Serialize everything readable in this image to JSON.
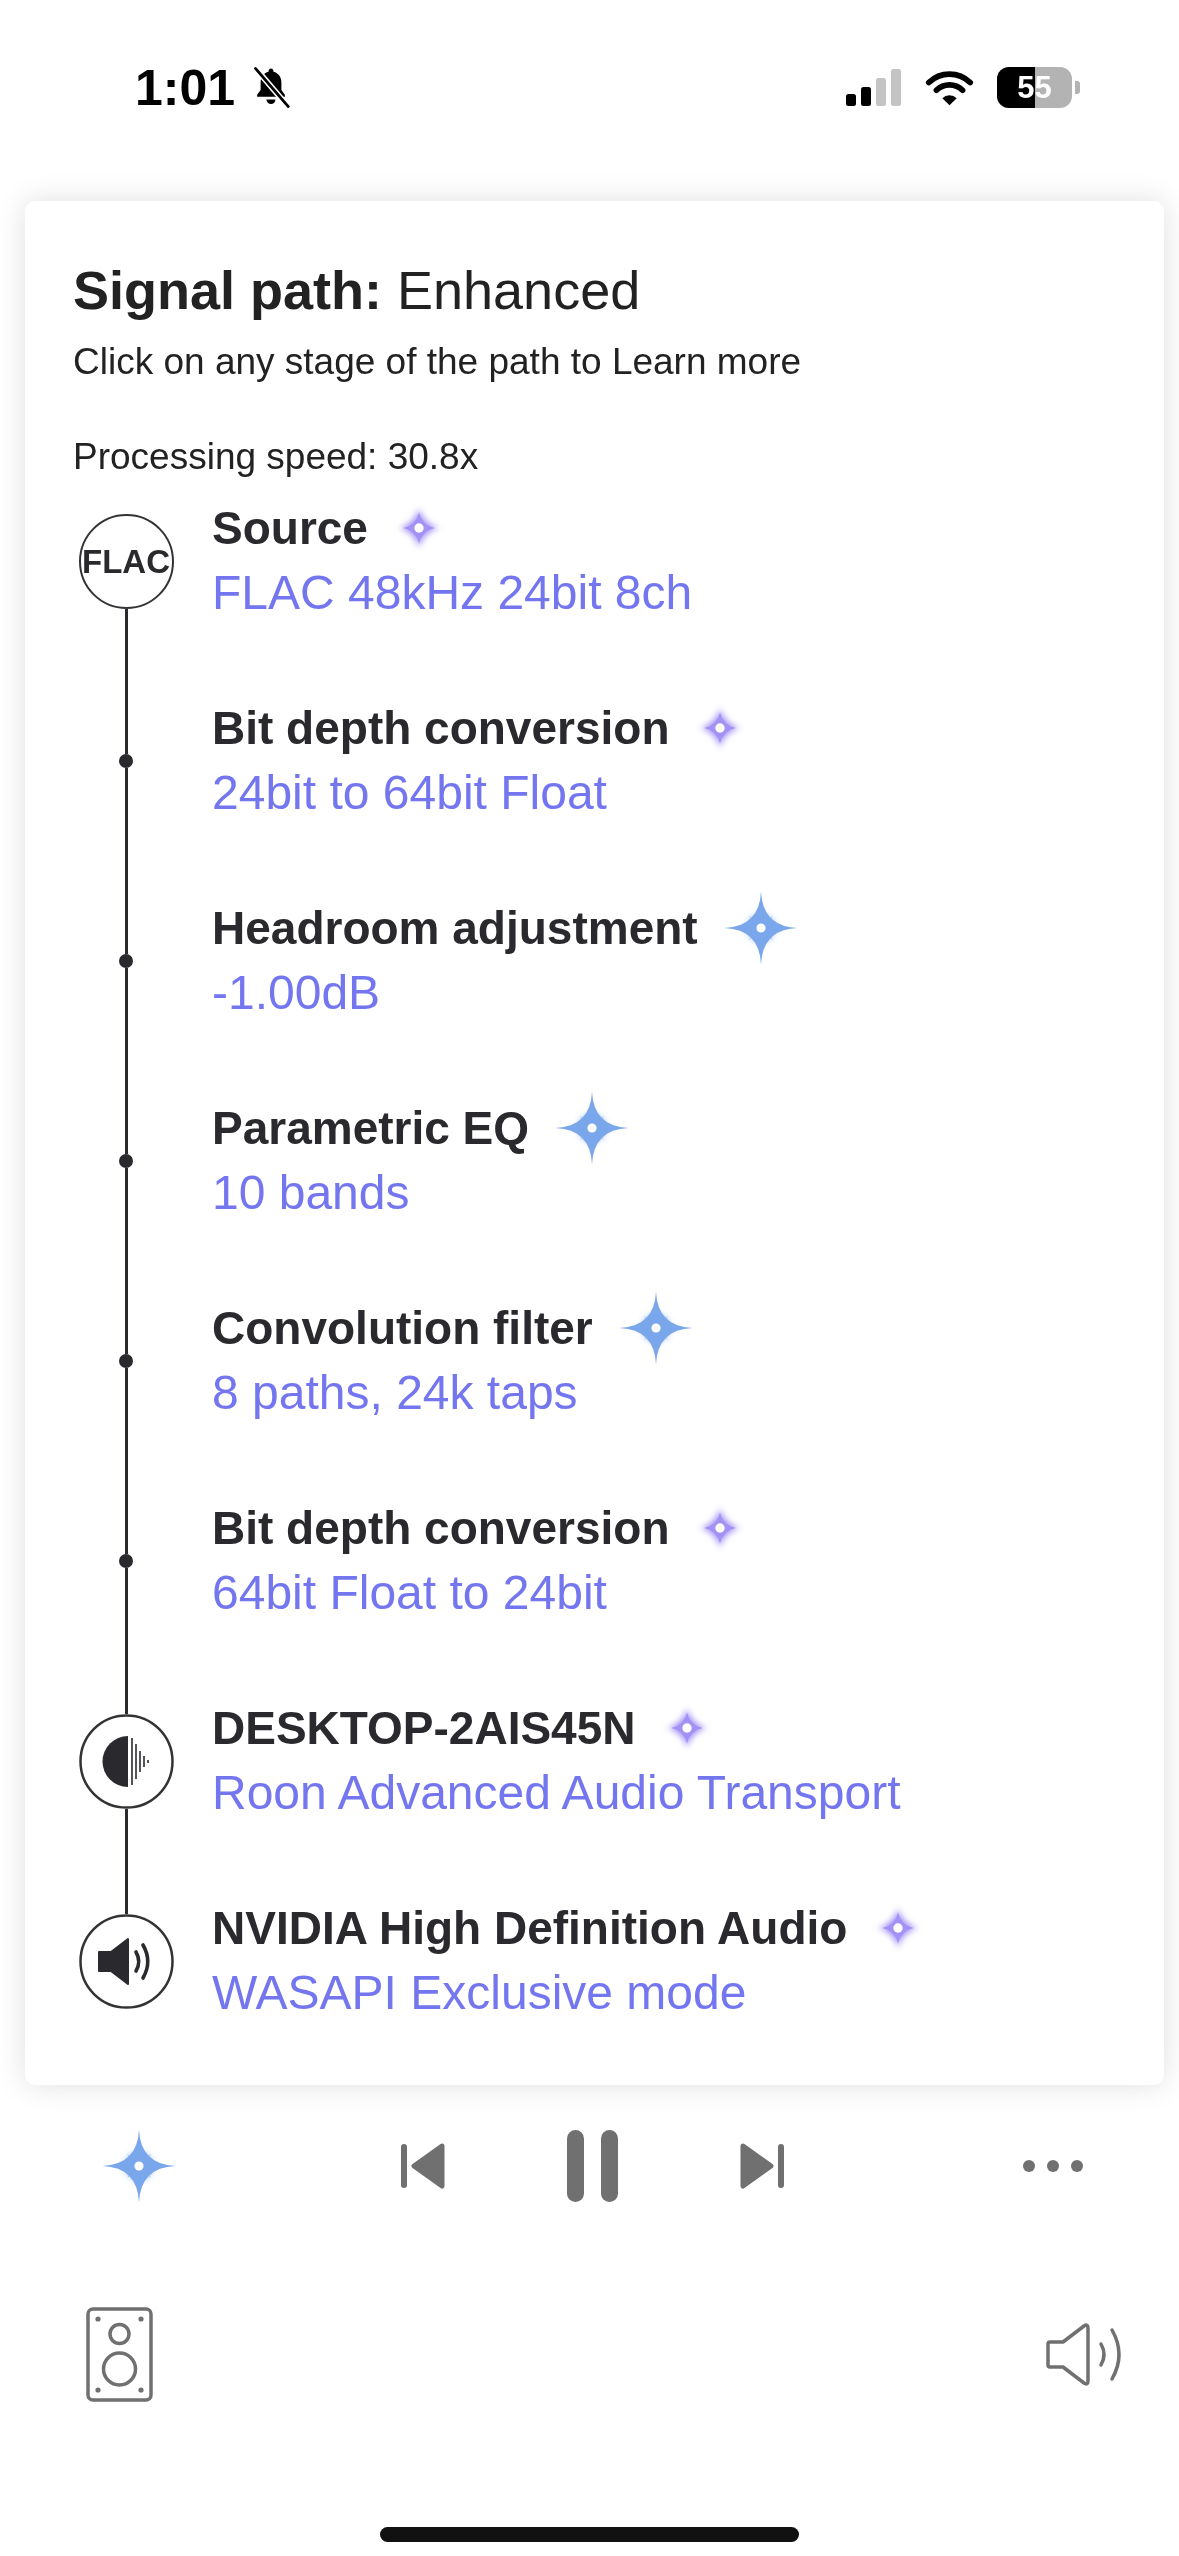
{
  "status_bar": {
    "time": "1:01",
    "battery": "55"
  },
  "signal_path": {
    "title": "**Signal path:** Enhanced",
    "hint": "Click on any stage of the path to Learn more",
    "processing_speed": "Processing speed: 30.8x",
    "stages": [
      {
        "node": {
          "kind": "badge",
          "label": "FLAC"
        },
        "title": "Source",
        "detail": "FLAC 48kHz 24bit 8ch",
        "indicator": {
          "kind": "glow",
          "color": "#a391f5"
        }
      },
      {
        "node": {
          "kind": "dot"
        },
        "title": "Bit depth conversion",
        "detail": "24bit to 64bit Float",
        "indicator": {
          "kind": "glow",
          "color": "#a391f5"
        }
      },
      {
        "node": {
          "kind": "dot"
        },
        "title": "Headroom adjustment",
        "detail": "-1.00dB",
        "indicator": {
          "kind": "star",
          "color": "#7aa7ec"
        }
      },
      {
        "node": {
          "kind": "dot"
        },
        "title": "Parametric EQ",
        "detail": "10 bands",
        "indicator": {
          "kind": "star",
          "color": "#7aa7ec"
        }
      },
      {
        "node": {
          "kind": "dot"
        },
        "title": "Convolution filter",
        "detail": "8 paths, 24k taps",
        "indicator": {
          "kind": "star",
          "color": "#7aa7ec"
        }
      },
      {
        "node": {
          "kind": "dot"
        },
        "title": "Bit depth conversion",
        "detail": "64bit Float to 24bit",
        "indicator": {
          "kind": "glow",
          "color": "#a391f5"
        }
      },
      {
        "node": {
          "kind": "transport"
        },
        "title": "DESKTOP-2AIS45N",
        "detail": "Roon Advanced Audio Transport",
        "indicator": {
          "kind": "glow",
          "color": "#a391f5"
        }
      },
      {
        "node": {
          "kind": "speaker"
        },
        "title": "NVIDIA High Definition Audio",
        "detail": "WASAPI Exclusive mode",
        "indicator": {
          "kind": "glow",
          "color": "#a391f5"
        }
      }
    ]
  },
  "player": {
    "playing": true,
    "indicator": {
      "kind": "star",
      "color": "#7aa7ec"
    }
  }
}
